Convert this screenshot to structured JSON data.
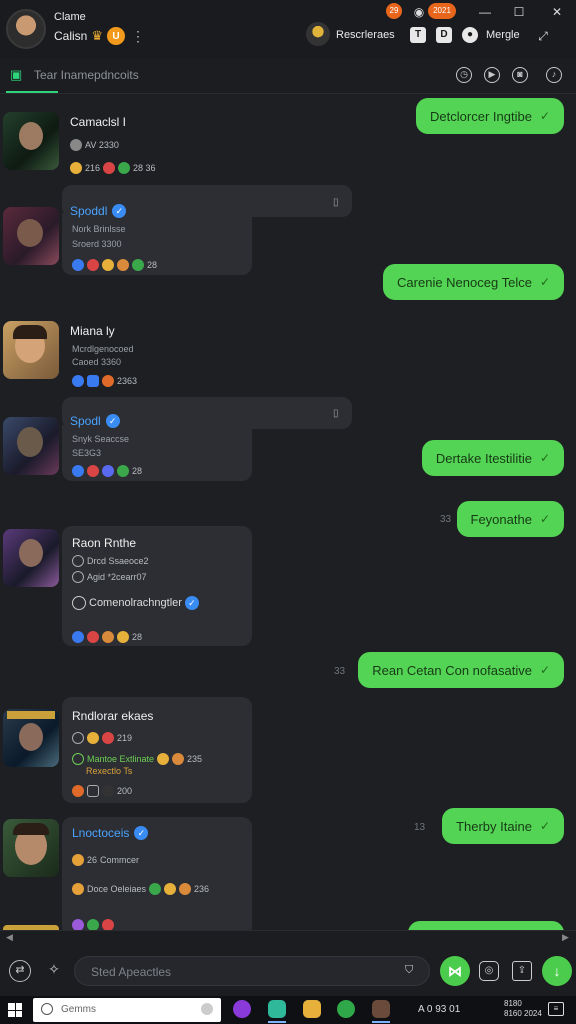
{
  "header": {
    "user_name": "Clame",
    "user_sub": "Calisn",
    "coin": "U",
    "badge_text": "2021",
    "badge_small": "29",
    "contact_name": "Rescrleraes",
    "mode_label": "Mergle",
    "icons": [
      "crown-icon",
      "coin-icon",
      "more-icon",
      "eye-icon",
      "minimize-icon",
      "maximize-icon",
      "close-icon",
      "contact-avatar",
      "t-icon",
      "d-icon",
      "record-icon",
      "expand-icon"
    ]
  },
  "subbar": {
    "title": "Tear Inamepdncoits",
    "icons": [
      "chat-icon",
      "clock-icon",
      "play-icon",
      "camera-icon",
      "mic-icon"
    ]
  },
  "messages": {
    "sent": [
      {
        "text": "Detclorcer Ingtibe"
      },
      {
        "text": "Carenie Nenoceg Telce"
      },
      {
        "text": "Dertake Itestilitie"
      },
      {
        "text": "Feyonathe",
        "meta": "33"
      },
      {
        "text": "Rean Cetan Con nofasative",
        "meta": "33"
      },
      {
        "text": "Therby Itaine",
        "meta": "13"
      }
    ],
    "received": [
      {
        "name": "Camaclsl I",
        "lines": [
          "AV 2330"
        ],
        "stats": "216",
        "stats2": "28 36"
      },
      {
        "name": "Spoddl",
        "lines": [
          "Nork Brinlsse",
          "Sroerd 3300"
        ],
        "stats": "28"
      },
      {
        "name": "Miana ly",
        "lines": [
          "Mcrdlgenocoed",
          "Caoed 3360"
        ],
        "stats": "2363"
      },
      {
        "name": "Spodl",
        "lines": [
          "Snyk Seaccse",
          "SE3G3"
        ],
        "stats": "28"
      },
      {
        "name": "Raon Rnthe",
        "lines": [
          "Drcd Ssaeoce2",
          "Agid *2cearr07"
        ],
        "subline": "Comenolrachngtler",
        "stats": "28"
      },
      {
        "name": "Rndlorar ekaes",
        "lines": [
          "Mantoe Extlinate",
          "Rexectlo Ts"
        ],
        "stats": "219",
        "stats2": "235",
        "stats3": "200"
      },
      {
        "name": "Lnoctoceis",
        "lines": [
          "Commcer"
        ],
        "subline": "Doce Oeleiaes",
        "stats": "26",
        "stats2": "236"
      }
    ]
  },
  "input": {
    "placeholder": "Sted Apeactles"
  },
  "taskbar": {
    "search_placeholder": "Gemms",
    "tray_text": "A 0 93 01",
    "clock_line1": "8180",
    "clock_line2": "8160 2024"
  }
}
